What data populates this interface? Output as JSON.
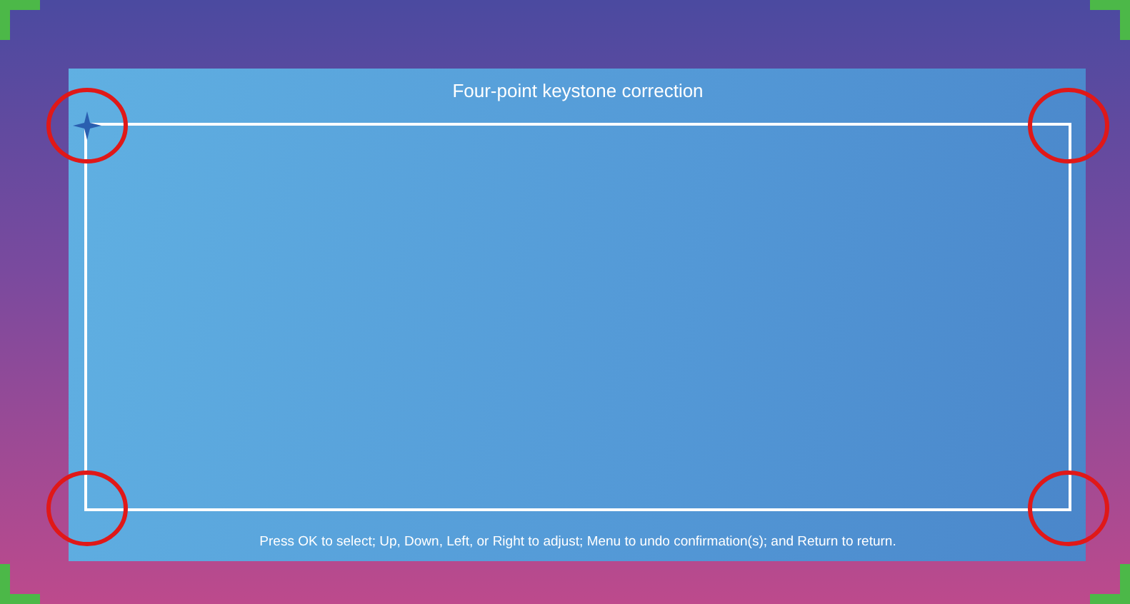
{
  "screen": {
    "title": "Four-point keystone correction",
    "hint": "Press OK to select; Up, Down, Left, or Right to adjust; Menu to undo confirmation(s); and Return to return.",
    "corners": [
      {
        "selected": true
      },
      {
        "selected": false
      },
      {
        "selected": false
      },
      {
        "selected": false
      }
    ]
  }
}
